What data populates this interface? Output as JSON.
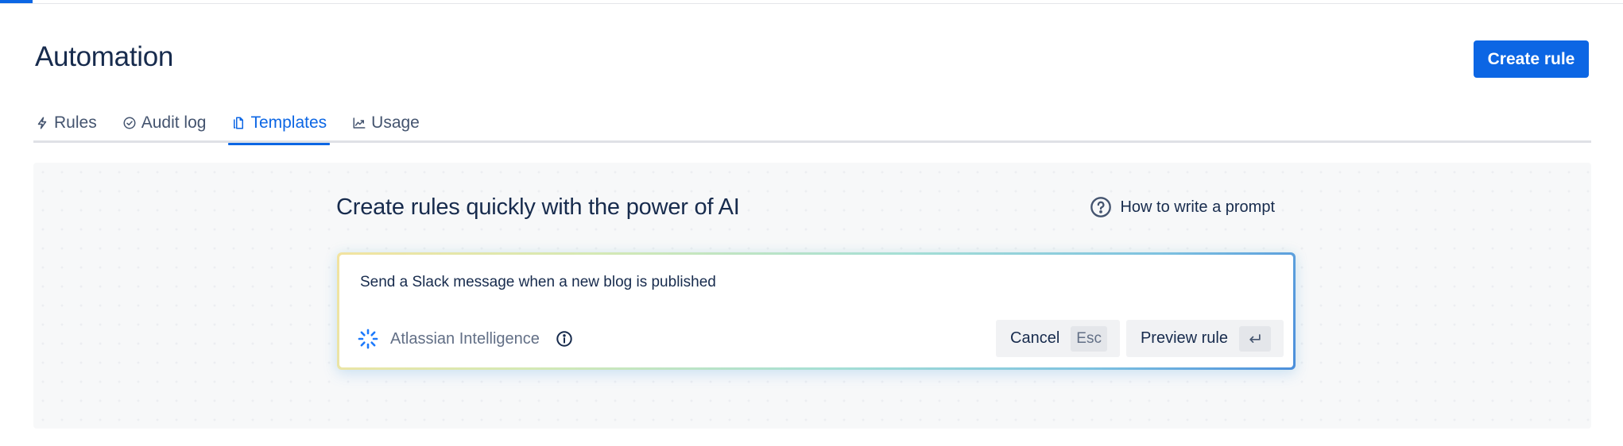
{
  "top_strip": {
    "progress_percent": 2
  },
  "header": {
    "title": "Automation",
    "create_button_label": "Create rule"
  },
  "tabs": [
    {
      "label": "Rules",
      "icon": "lightning-icon",
      "active": false
    },
    {
      "label": "Audit log",
      "icon": "check-circle-icon",
      "active": false
    },
    {
      "label": "Templates",
      "icon": "copy-document-icon",
      "active": true
    },
    {
      "label": "Usage",
      "icon": "line-chart-icon",
      "active": false
    }
  ],
  "ai_panel": {
    "heading": "Create rules quickly with the power of AI",
    "help_link_label": "How to write a prompt",
    "prompt": {
      "value": "Send a Slack message when a new blog is published",
      "placeholder": ""
    },
    "brand_label": "Atlassian Intelligence",
    "cancel_label": "Cancel",
    "cancel_shortcut": "Esc",
    "preview_label": "Preview rule",
    "preview_shortcut": "enter-icon"
  },
  "colors": {
    "brand_blue": "#0c66e4",
    "text_primary": "#172b4d",
    "text_subtle": "#44546f",
    "panel_bg": "#f7f8f9"
  }
}
